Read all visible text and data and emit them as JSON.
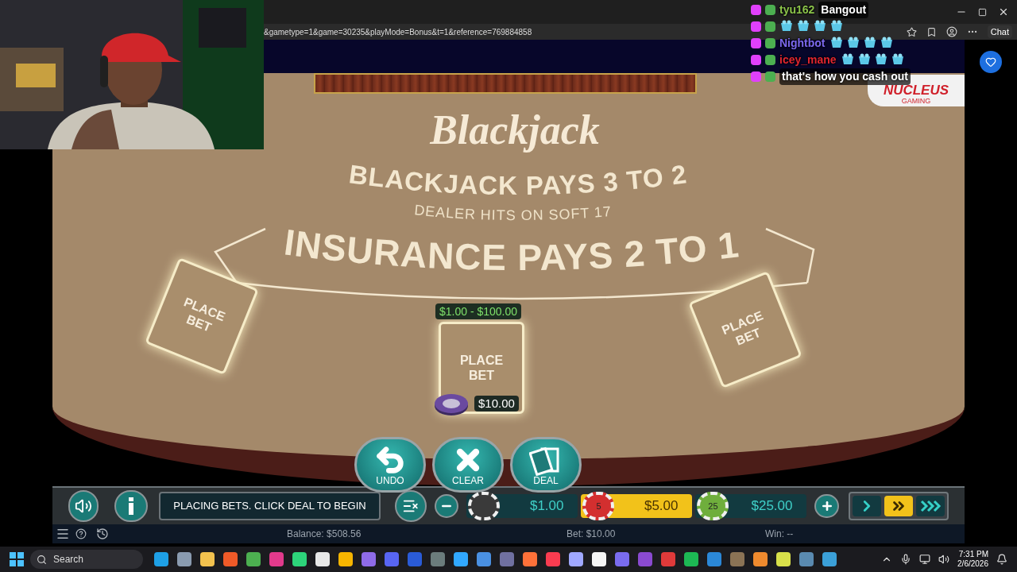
{
  "browser": {
    "url": "&gametype=1&game=30235&playMode=Bonus&t=1&reference=769884858",
    "chat_button": "Chat"
  },
  "chat_overlay": [
    {
      "kind": "text",
      "user": "tyu162",
      "color": "#8bc34a",
      "message": "Bangout"
    },
    {
      "kind": "emotes"
    },
    {
      "kind": "emotes",
      "user": "Nightbot",
      "color": "#7b68ee"
    },
    {
      "kind": "emotes",
      "user": "icey_mane",
      "color": "#e0252f"
    },
    {
      "kind": "text",
      "message": "that's how you cash out"
    }
  ],
  "game": {
    "title": "Blackjack",
    "rule": "BLACKJACK PAYS 3 TO 2",
    "dealer_rule": "DEALER HITS ON SOFT 17",
    "insurance": "INSURANCE PAYS 2 TO 1",
    "logo": "NUCLEUS",
    "logo_sub": "GAMING",
    "spots": [
      {
        "label": "PLACE BET",
        "kind": "left"
      },
      {
        "label": "PLACE BET",
        "kind": "center",
        "limits": "$1.00 - $100.00",
        "bet": "$10.00"
      },
      {
        "label": "PLACE BET",
        "kind": "right"
      }
    ],
    "actions": [
      {
        "kind": "undo",
        "label": "UNDO"
      },
      {
        "kind": "clear",
        "label": "CLEAR"
      },
      {
        "kind": "deal",
        "label": "DEAL"
      }
    ],
    "message": "PLACING BETS. CLICK DEAL TO BEGIN",
    "chips": [
      {
        "value": "$1.00",
        "color": "#3a3a3a",
        "selected": false
      },
      {
        "value": "$5.00",
        "chip_label": "5",
        "color": "#d32f2f",
        "selected": true
      },
      {
        "value": "$25.00",
        "chip_label": "25",
        "color": "#6fae3c",
        "selected": false
      }
    ],
    "speeds": [
      {
        "kind": "normal",
        "selected": false
      },
      {
        "kind": "fast",
        "selected": true
      },
      {
        "kind": "turbo",
        "selected": false
      }
    ],
    "status": {
      "balance": "Balance: $508.56",
      "bet": "Bet: $10.00",
      "win": "Win: --"
    }
  },
  "taskbar": {
    "search": "Search",
    "time": "7:31 PM",
    "date": "2/6/2026",
    "apps": [
      {
        "color": "#1ea0e6"
      },
      {
        "color": "#8a9bb0"
      },
      {
        "color": "#f2c14e"
      },
      {
        "color": "#f05a28"
      },
      {
        "color": "#4caf50"
      },
      {
        "color": "#e23a8c"
      },
      {
        "color": "#2dd47a"
      },
      {
        "color": "#e8e8e8"
      },
      {
        "color": "#f7b500"
      },
      {
        "color": "#8f6be8"
      },
      {
        "color": "#5865f2"
      },
      {
        "color": "#2a5bd7"
      },
      {
        "color": "#6b7c7c"
      },
      {
        "color": "#31a8ff"
      },
      {
        "color": "#4a90e2"
      },
      {
        "color": "#7070a0"
      },
      {
        "color": "#ff7139"
      },
      {
        "color": "#fa3c50"
      },
      {
        "color": "#a0a8ff"
      },
      {
        "color": "#f5f5f5"
      },
      {
        "color": "#7a6cf0"
      },
      {
        "color": "#8a4ad0"
      },
      {
        "color": "#e03a3a"
      },
      {
        "color": "#1db954"
      },
      {
        "color": "#2b88d8"
      },
      {
        "color": "#8b7355"
      },
      {
        "color": "#ef8a2e"
      },
      {
        "color": "#d8e04a"
      },
      {
        "color": "#5a8ab0"
      },
      {
        "color": "#3ba0d8"
      }
    ]
  }
}
